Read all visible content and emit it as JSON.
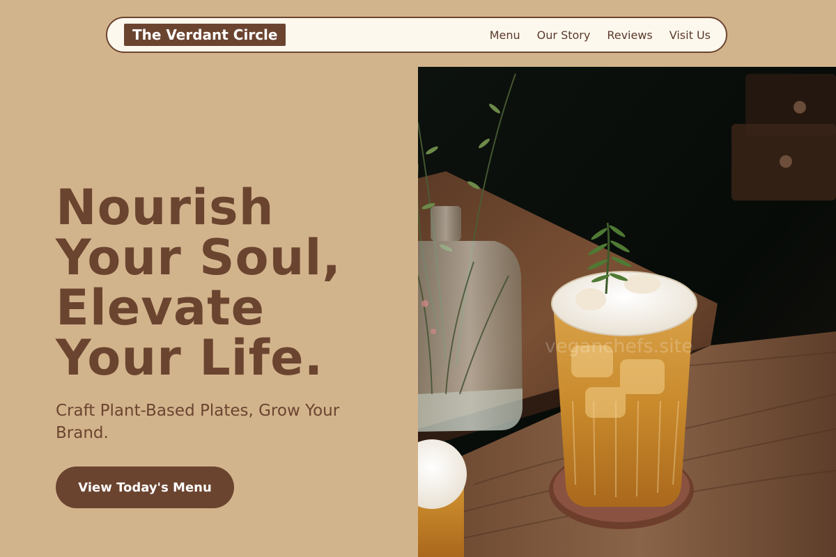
{
  "brand": {
    "name": "The Verdant Circle"
  },
  "nav": {
    "items": [
      {
        "label": "Menu"
      },
      {
        "label": "Our Story"
      },
      {
        "label": "Reviews"
      },
      {
        "label": "Visit Us"
      }
    ]
  },
  "hero": {
    "title_lines": [
      "Nourish",
      "Your Soul,",
      "Elevate",
      "Your Life."
    ],
    "subtitle": "Craft Plant-Based Plates, Grow Your Brand.",
    "cta_label": "View Today's Menu"
  },
  "image": {
    "watermark": "veganchefs.site",
    "icon": "iced-tea-photo"
  },
  "colors": {
    "background": "#d2b48c",
    "accent": "#6b4430",
    "nav_background": "#fdf8ee",
    "button_text": "#ffffff"
  }
}
